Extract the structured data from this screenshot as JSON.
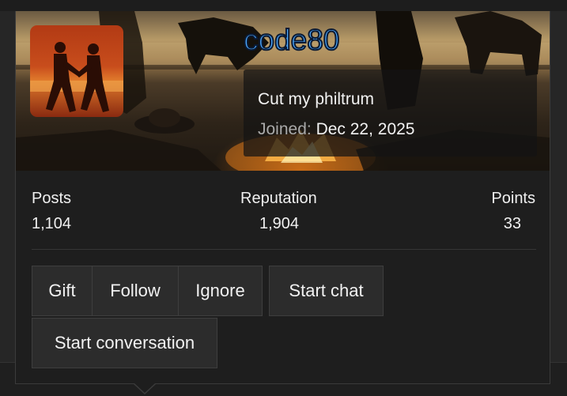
{
  "profile": {
    "username": "code80",
    "tagline": "Cut my philtrum",
    "joined_label": "Joined:",
    "joined_date": "Dec 22, 2025"
  },
  "stats": {
    "posts_label": "Posts",
    "posts_value": "1,104",
    "reputation_label": "Reputation",
    "reputation_value": "1,904",
    "points_label": "Points",
    "points_value": "33"
  },
  "actions": {
    "gift": "Gift",
    "follow": "Follow",
    "ignore": "Ignore",
    "start_chat": "Start chat",
    "start_conversation": "Start conversation"
  },
  "colors": {
    "username": "#4aa8ff",
    "card_bg": "#1e1e1e",
    "button_bg": "#2c2c2c"
  }
}
